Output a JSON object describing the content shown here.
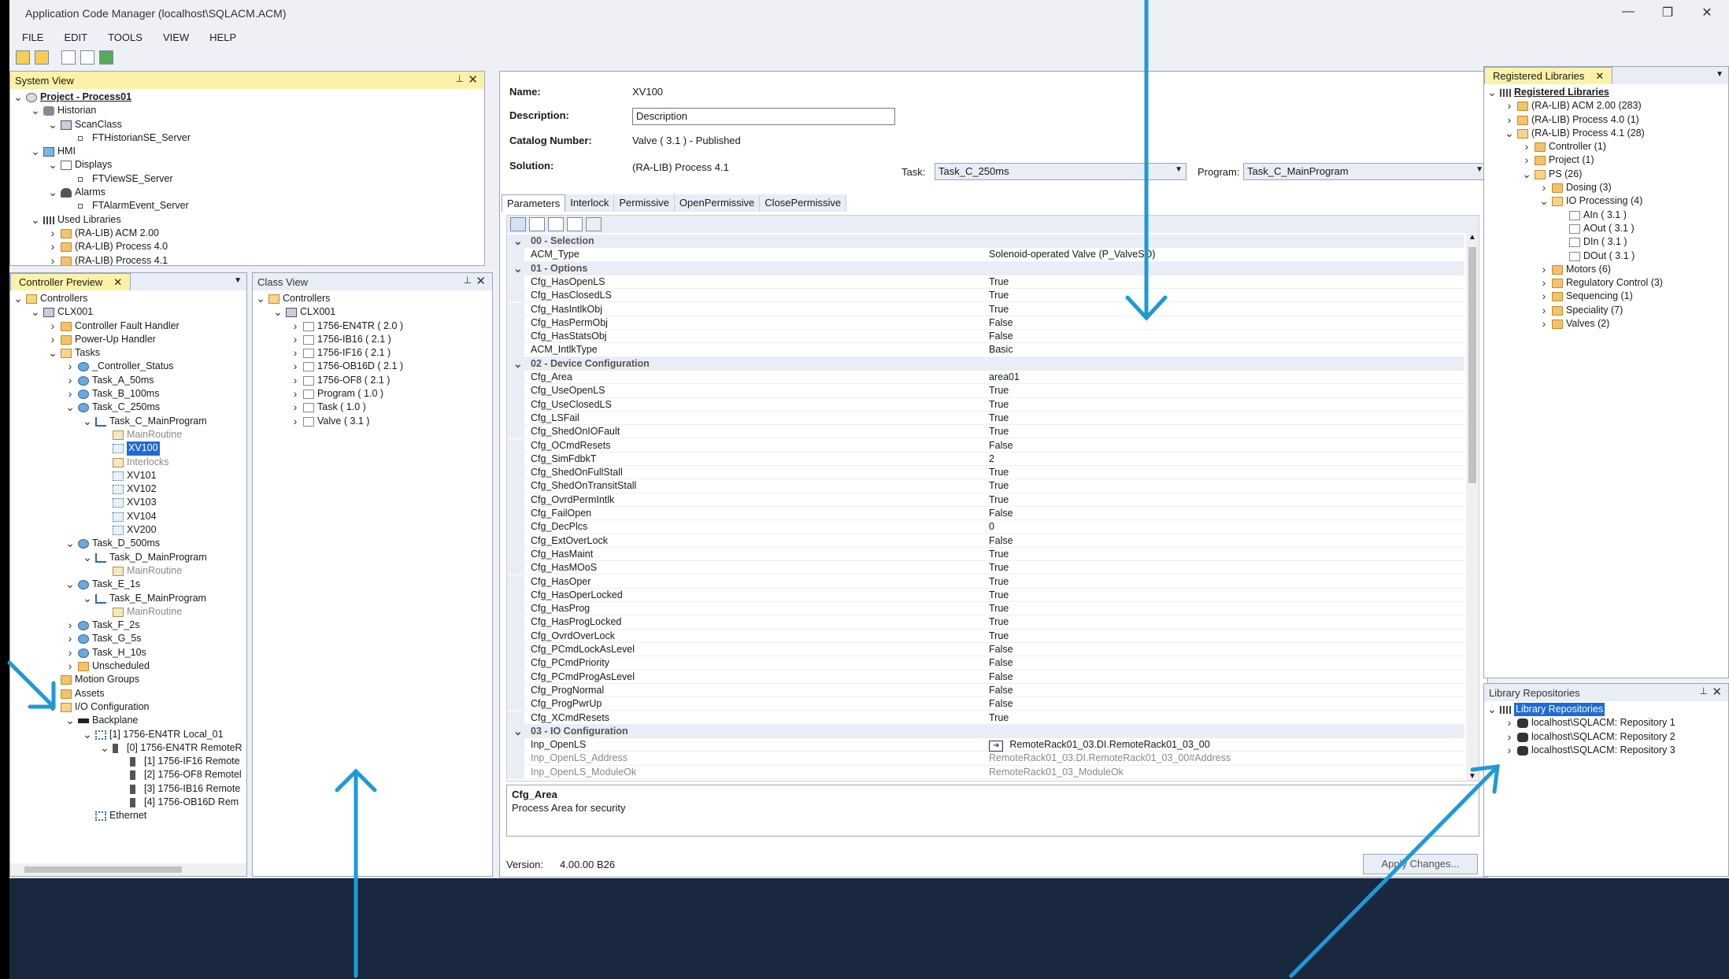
{
  "window": {
    "title": "Application Code Manager (localhost\\SQLACM.ACM)",
    "minimize": "—",
    "restore": "❐",
    "close": "✕"
  },
  "menu": [
    "FILE",
    "EDIT",
    "TOOLS",
    "VIEW",
    "HELP"
  ],
  "system_view": {
    "title": "System View",
    "tree": [
      {
        "label": "Project - Process01",
        "depth": 0,
        "expander": "v",
        "icon": "proj",
        "bold": true
      },
      {
        "label": "Historian",
        "depth": 1,
        "expander": "v",
        "icon": "hist"
      },
      {
        "label": "ScanClass",
        "depth": 2,
        "expander": "v",
        "icon": "ctrl"
      },
      {
        "label": "FTHistorianSE_Server",
        "depth": 3,
        "expander": "",
        "icon": "small"
      },
      {
        "label": "HMI",
        "depth": 1,
        "expander": "v",
        "icon": "mon"
      },
      {
        "label": "Displays",
        "depth": 2,
        "expander": "v",
        "icon": "disp"
      },
      {
        "label": "FTViewSE_Server",
        "depth": 3,
        "expander": "",
        "icon": "small"
      },
      {
        "label": "Alarms",
        "depth": 2,
        "expander": "v",
        "icon": "bell"
      },
      {
        "label": "FTAlarmEvent_Server",
        "depth": 3,
        "expander": "",
        "icon": "small"
      },
      {
        "label": "Used Libraries",
        "depth": 1,
        "expander": "v",
        "icon": "lib"
      },
      {
        "label": "(RA-LIB) ACM 2.00",
        "depth": 2,
        "expander": ">",
        "icon": "folder"
      },
      {
        "label": "(RA-LIB) Process 4.0",
        "depth": 2,
        "expander": ">",
        "icon": "folder"
      },
      {
        "label": "(RA-LIB) Process 4.1",
        "depth": 2,
        "expander": ">",
        "icon": "folder"
      }
    ]
  },
  "controller_preview": {
    "title": "Controller Preview",
    "tree": [
      {
        "label": "Controllers",
        "depth": 0,
        "expander": "v",
        "icon": "folder-open"
      },
      {
        "label": "CLX001",
        "depth": 1,
        "expander": "v",
        "icon": "ctrl"
      },
      {
        "label": "Controller Fault Handler",
        "depth": 2,
        "expander": ">",
        "icon": "folder"
      },
      {
        "label": "Power-Up Handler",
        "depth": 2,
        "expander": ">",
        "icon": "folder"
      },
      {
        "label": "Tasks",
        "depth": 2,
        "expander": "v",
        "icon": "folder-open"
      },
      {
        "label": "_Controller_Status",
        "depth": 3,
        "expander": ">",
        "icon": "task"
      },
      {
        "label": "Task_A_50ms",
        "depth": 3,
        "expander": ">",
        "icon": "task"
      },
      {
        "label": "Task_B_100ms",
        "depth": 3,
        "expander": ">",
        "icon": "task"
      },
      {
        "label": "Task_C_250ms",
        "depth": 3,
        "expander": "v",
        "icon": "task"
      },
      {
        "label": "Task_C_MainProgram",
        "depth": 4,
        "expander": "v",
        "icon": "prog"
      },
      {
        "label": "MainRoutine",
        "depth": 5,
        "expander": "",
        "icon": "routine",
        "grey": true
      },
      {
        "label": "XV100",
        "depth": 5,
        "expander": "",
        "icon": "obj",
        "selected": true
      },
      {
        "label": "Interlocks",
        "depth": 5,
        "expander": "",
        "icon": "routine",
        "grey": true
      },
      {
        "label": "XV101",
        "depth": 5,
        "expander": "",
        "icon": "obj"
      },
      {
        "label": "XV102",
        "depth": 5,
        "expander": "",
        "icon": "obj"
      },
      {
        "label": "XV103",
        "depth": 5,
        "expander": "",
        "icon": "obj"
      },
      {
        "label": "XV104",
        "depth": 5,
        "expander": "",
        "icon": "obj"
      },
      {
        "label": "XV200",
        "depth": 5,
        "expander": "",
        "icon": "obj"
      },
      {
        "label": "Task_D_500ms",
        "depth": 3,
        "expander": "v",
        "icon": "task"
      },
      {
        "label": "Task_D_MainProgram",
        "depth": 4,
        "expander": "v",
        "icon": "prog"
      },
      {
        "label": "MainRoutine",
        "depth": 5,
        "expander": "",
        "icon": "routine",
        "grey": true
      },
      {
        "label": "Task_E_1s",
        "depth": 3,
        "expander": "v",
        "icon": "task"
      },
      {
        "label": "Task_E_MainProgram",
        "depth": 4,
        "expander": "v",
        "icon": "prog"
      },
      {
        "label": "MainRoutine",
        "depth": 5,
        "expander": "",
        "icon": "routine",
        "grey": true
      },
      {
        "label": "Task_F_2s",
        "depth": 3,
        "expander": ">",
        "icon": "task"
      },
      {
        "label": "Task_G_5s",
        "depth": 3,
        "expander": ">",
        "icon": "task"
      },
      {
        "label": "Task_H_10s",
        "depth": 3,
        "expander": ">",
        "icon": "task"
      },
      {
        "label": "Unscheduled",
        "depth": 3,
        "expander": ">",
        "icon": "folder"
      },
      {
        "label": "Motion Groups",
        "depth": 2,
        "expander": "",
        "icon": "folder"
      },
      {
        "label": "Assets",
        "depth": 2,
        "expander": ">",
        "icon": "folder"
      },
      {
        "label": "I/O Configuration",
        "depth": 2,
        "expander": "v",
        "icon": "folder-open"
      },
      {
        "label": "Backplane",
        "depth": 3,
        "expander": "v",
        "icon": "back"
      },
      {
        "label": "[1] 1756-EN4TR Local_01",
        "depth": 4,
        "expander": "v",
        "icon": "net"
      },
      {
        "label": "[0] 1756-EN4TR RemoteR",
        "depth": 5,
        "expander": "v",
        "icon": "mod"
      },
      {
        "label": "[1] 1756-IF16 Remote",
        "depth": 6,
        "expander": "",
        "icon": "mod"
      },
      {
        "label": "[2] 1756-OF8 Remotel",
        "depth": 6,
        "expander": "",
        "icon": "mod"
      },
      {
        "label": "[3] 1756-IB16 Remote",
        "depth": 6,
        "expander": "",
        "icon": "mod"
      },
      {
        "label": "[4] 1756-OB16D Rem",
        "depth": 6,
        "expander": "",
        "icon": "mod"
      },
      {
        "label": "Ethernet",
        "depth": 4,
        "expander": "",
        "icon": "net"
      }
    ]
  },
  "class_view": {
    "title": "Class View",
    "tree": [
      {
        "label": "Controllers",
        "depth": 0,
        "expander": "v",
        "icon": "folder-open"
      },
      {
        "label": "CLX001",
        "depth": 1,
        "expander": "v",
        "icon": "ctrl"
      },
      {
        "label": "1756-EN4TR    ( 2.0 )",
        "depth": 2,
        "expander": ">",
        "icon": "obj2"
      },
      {
        "label": "1756-IB16    ( 2.1 )",
        "depth": 2,
        "expander": ">",
        "icon": "obj2"
      },
      {
        "label": "1756-IF16    ( 2.1 )",
        "depth": 2,
        "expander": ">",
        "icon": "obj2"
      },
      {
        "label": "1756-OB16D    ( 2.1 )",
        "depth": 2,
        "expander": ">",
        "icon": "obj2"
      },
      {
        "label": "1756-OF8    ( 2.1 )",
        "depth": 2,
        "expander": ">",
        "icon": "obj2"
      },
      {
        "label": "Program    ( 1.0 )",
        "depth": 2,
        "expander": ">",
        "icon": "obj2"
      },
      {
        "label": "Task    ( 1.0 )",
        "depth": 2,
        "expander": ">",
        "icon": "obj2"
      },
      {
        "label": "Valve    ( 3.1 )",
        "depth": 2,
        "expander": ">",
        "icon": "obj2"
      }
    ]
  },
  "editor": {
    "name_label": "Name:",
    "name_value": "XV100",
    "description_label": "Description:",
    "description_value": "Description",
    "catalog_label": "Catalog Number:",
    "catalog_value": "Valve    ( 3.1 )  -  Published",
    "solution_label": "Solution:",
    "solution_value": "(RA-LIB) Process 4.1",
    "task_label": "Task:",
    "task_value": "Task_C_250ms",
    "program_label": "Program:",
    "program_value": "Task_C_MainProgram",
    "tabs": [
      "Parameters",
      "Interlock",
      "Permissive",
      "OpenPermissive",
      "ClosePermissive"
    ],
    "grid_rows": [
      {
        "cat": true,
        "name": "00 - Selection"
      },
      {
        "name": "ACM_Type",
        "value": "Solenoid-operated Valve (P_ValveSO)"
      },
      {
        "cat": true,
        "name": "01 - Options"
      },
      {
        "name": "Cfg_HasOpenLS",
        "value": "True"
      },
      {
        "name": "Cfg_HasClosedLS",
        "value": "True"
      },
      {
        "name": "Cfg_HasIntlkObj",
        "value": "True"
      },
      {
        "name": "Cfg_HasPermObj",
        "value": "False"
      },
      {
        "name": "Cfg_HasStatsObj",
        "value": "False"
      },
      {
        "name": "ACM_IntlkType",
        "value": "Basic"
      },
      {
        "cat": true,
        "name": "02 - Device Configuration"
      },
      {
        "name": "Cfg_Area",
        "value": "area01"
      },
      {
        "name": "Cfg_UseOpenLS",
        "value": "True"
      },
      {
        "name": "Cfg_UseClosedLS",
        "value": "True"
      },
      {
        "name": "Cfg_LSFail",
        "value": "True"
      },
      {
        "name": "Cfg_ShedOnIOFault",
        "value": "True"
      },
      {
        "name": "Cfg_OCmdResets",
        "value": "False"
      },
      {
        "name": "Cfg_SimFdbkT",
        "value": "2"
      },
      {
        "name": "Cfg_ShedOnFullStall",
        "value": "True"
      },
      {
        "name": "Cfg_ShedOnTransitStall",
        "value": "True"
      },
      {
        "name": "Cfg_OvrdPermIntlk",
        "value": "True"
      },
      {
        "name": "Cfg_FailOpen",
        "value": "False"
      },
      {
        "name": "Cfg_DecPlcs",
        "value": "0"
      },
      {
        "name": "Cfg_ExtOverLock",
        "value": "False"
      },
      {
        "name": "Cfg_HasMaint",
        "value": "True"
      },
      {
        "name": "Cfg_HasMOoS",
        "value": "True"
      },
      {
        "name": "Cfg_HasOper",
        "value": "True"
      },
      {
        "name": "Cfg_HasOperLocked",
        "value": "True"
      },
      {
        "name": "Cfg_HasProg",
        "value": "True"
      },
      {
        "name": "Cfg_HasProgLocked",
        "value": "True"
      },
      {
        "name": "Cfg_OvrdOverLock",
        "value": "True"
      },
      {
        "name": "Cfg_PCmdLockAsLevel",
        "value": "False"
      },
      {
        "name": "Cfg_PCmdPriority",
        "value": "False"
      },
      {
        "name": "Cfg_PCmdProgAsLevel",
        "value": "False"
      },
      {
        "name": "Cfg_ProgNormal",
        "value": "False"
      },
      {
        "name": "Cfg_ProgPwrUp",
        "value": "False"
      },
      {
        "name": "Cfg_XCmdResets",
        "value": "True"
      },
      {
        "cat": true,
        "name": "03 - IO Configuration"
      },
      {
        "name": "Inp_OpenLS",
        "value": "RemoteRack01_03.DI.RemoteRack01_03_00",
        "link": true
      },
      {
        "name": "Inp_OpenLS_Address",
        "value": "RemoteRack01_03.DI.RemoteRack01_03_00#Address",
        "grey": true
      },
      {
        "name": "Inp_OpenLS_ModuleOk",
        "value": "RemoteRack01_03_ModuleOk",
        "grey": true
      }
    ],
    "desc_title": "Cfg_Area",
    "desc_text": "Process Area for security",
    "version_label": "Version:",
    "version_value": "4.00.00 B26",
    "apply_label": "Apply Changes..."
  },
  "registered_libraries": {
    "title": "Registered Libraries",
    "tree": [
      {
        "label": "Registered Libraries",
        "depth": 0,
        "expander": "v",
        "icon": "lib",
        "bold": true
      },
      {
        "label": "(RA-LIB) ACM 2.00  (283)",
        "depth": 1,
        "expander": ">",
        "icon": "folder"
      },
      {
        "label": "(RA-LIB) Process 4.0  (1)",
        "depth": 1,
        "expander": ">",
        "icon": "folder"
      },
      {
        "label": "(RA-LIB) Process 4.1  (28)",
        "depth": 1,
        "expander": "v",
        "icon": "folder-open"
      },
      {
        "label": "Controller  (1)",
        "depth": 2,
        "expander": ">",
        "icon": "folder"
      },
      {
        "label": "Project  (1)",
        "depth": 2,
        "expander": ">",
        "icon": "folder"
      },
      {
        "label": "PS  (26)",
        "depth": 2,
        "expander": "v",
        "icon": "folder-open"
      },
      {
        "label": "Dosing  (3)",
        "depth": 3,
        "expander": ">",
        "icon": "folder"
      },
      {
        "label": "IO Processing  (4)",
        "depth": 3,
        "expander": "v",
        "icon": "folder-open"
      },
      {
        "label": "AIn  ( 3.1 )",
        "depth": 4,
        "expander": "",
        "icon": "obj2"
      },
      {
        "label": "AOut  ( 3.1 )",
        "depth": 4,
        "expander": "",
        "icon": "obj2"
      },
      {
        "label": "DIn  ( 3.1 )",
        "depth": 4,
        "expander": "",
        "icon": "obj2"
      },
      {
        "label": "DOut  ( 3.1 )",
        "depth": 4,
        "expander": "",
        "icon": "obj2"
      },
      {
        "label": "Motors  (6)",
        "depth": 3,
        "expander": ">",
        "icon": "folder"
      },
      {
        "label": "Regulatory Control  (3)",
        "depth": 3,
        "expander": ">",
        "icon": "folder"
      },
      {
        "label": "Sequencing  (1)",
        "depth": 3,
        "expander": ">",
        "icon": "folder"
      },
      {
        "label": "Speciality  (7)",
        "depth": 3,
        "expander": ">",
        "icon": "folder"
      },
      {
        "label": "Valves  (2)",
        "depth": 3,
        "expander": ">",
        "icon": "folder"
      }
    ]
  },
  "library_repositories": {
    "title": "Library Repositories",
    "tree": [
      {
        "label": "Library Repositories",
        "depth": 0,
        "expander": "v",
        "icon": "lib",
        "selected": true
      },
      {
        "label": "localhost\\SQLACM: Repository 1",
        "depth": 1,
        "expander": ">",
        "icon": "db"
      },
      {
        "label": "localhost\\SQLACM: Repository 2",
        "depth": 1,
        "expander": ">",
        "icon": "db"
      },
      {
        "label": "localhost\\SQLACM: Repository 3",
        "depth": 1,
        "expander": ">",
        "icon": "db"
      }
    ]
  },
  "colors": {
    "active_header": "#fbf1a8",
    "selection": "#1e6bd6",
    "callout_arrow": "#1d9ad6",
    "bottom_band": "#19273f"
  }
}
